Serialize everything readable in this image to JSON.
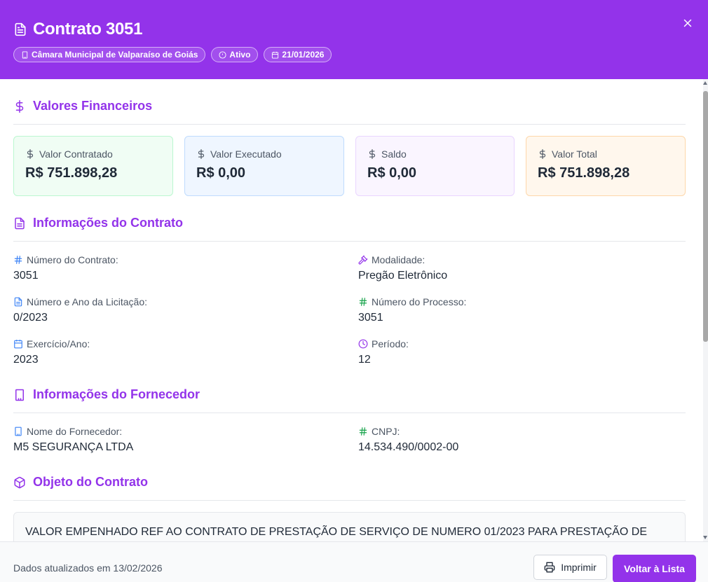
{
  "header": {
    "title": "Contrato 3051",
    "badges": {
      "entity": "Câmara Municipal de Valparaíso de Goiás",
      "status": "Ativo",
      "date": "21/01/2026"
    }
  },
  "financial": {
    "title": "Valores Financeiros",
    "cards": [
      {
        "label": "Valor Contratado",
        "value": "R$ 751.898,28"
      },
      {
        "label": "Valor Executado",
        "value": "R$ 0,00"
      },
      {
        "label": "Saldo",
        "value": "R$ 0,00"
      },
      {
        "label": "Valor Total",
        "value": "R$ 751.898,28"
      }
    ]
  },
  "contract_info": {
    "title": "Informações do Contrato",
    "fields": [
      {
        "label": "Número do Contrato:",
        "value": "3051"
      },
      {
        "label": "Modalidade:",
        "value": "Pregão Eletrônico"
      },
      {
        "label": "Número e Ano da Licitação:",
        "value": "0/2023"
      },
      {
        "label": "Número do Processo:",
        "value": "3051"
      },
      {
        "label": "Exercício/Ano:",
        "value": "2023"
      },
      {
        "label": "Período:",
        "value": "12"
      }
    ]
  },
  "supplier": {
    "title": "Informações do Fornecedor",
    "fields": [
      {
        "label": "Nome do Fornecedor:",
        "value": "M5 SEGURANÇA LTDA"
      },
      {
        "label": "CNPJ:",
        "value": "14.534.490/0002-00"
      }
    ]
  },
  "object": {
    "title": "Objeto do Contrato",
    "text": "VALOR EMPENHADO REF AO CONTRATO DE PRESTAÇÃO DE SERVIÇO DE NUMERO 01/2023 PARA PRESTAÇÃO DE"
  },
  "footer": {
    "updated": "Dados atualizados em 13/02/2026",
    "print_label": "Imprimir",
    "back_label": "Voltar à Lista"
  },
  "colors": {
    "accent": "#9333ea",
    "green": "#16a34a",
    "blue": "#3b82f6"
  },
  "icons": [
    "file-text-icon",
    "close-icon",
    "building-icon",
    "info-icon",
    "calendar-icon",
    "dollar-icon",
    "hash-icon",
    "gavel-icon",
    "clock-icon",
    "package-icon",
    "printer-icon"
  ]
}
